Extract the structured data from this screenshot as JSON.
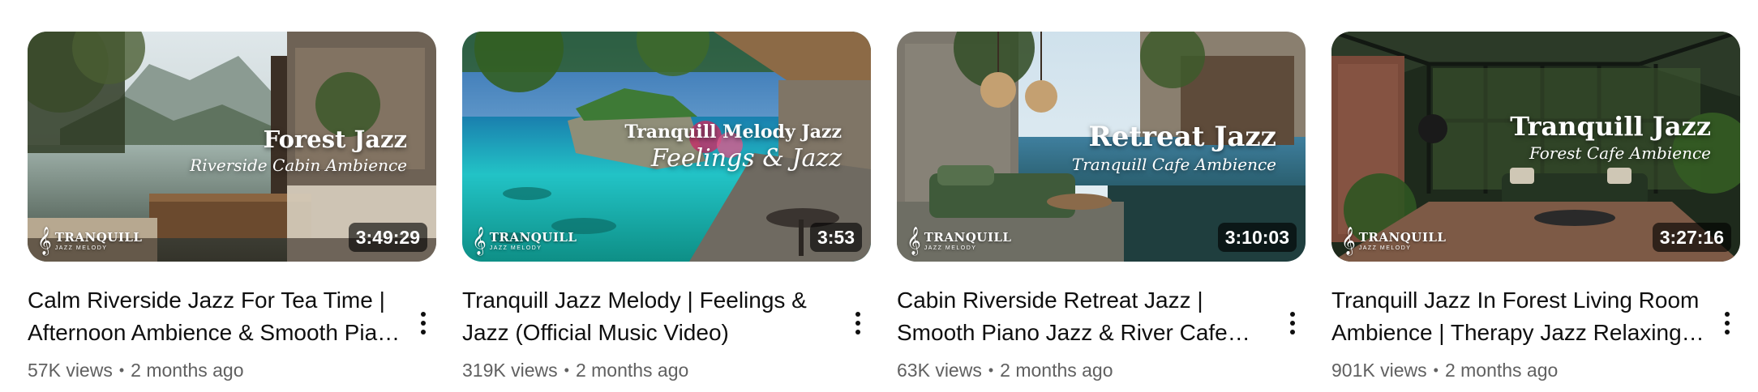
{
  "colors": {
    "title_text": "#0f0f0f",
    "secondary_text": "#606060",
    "duration_bg": "rgba(0,0,0,0.62)",
    "duration_text": "#ffffff"
  },
  "brand": {
    "name": "TRANQUILL",
    "tagline": "JAZZ MELODY"
  },
  "videos": [
    {
      "thumbnail": {
        "main": "Forest Jazz",
        "sub": "Riverside Cabin Ambience",
        "scene": "lake-cabin"
      },
      "duration": "3:49:29",
      "title": "Calm Riverside Jazz For Tea Time | Afternoon Ambience & Smooth Piano Jazz Music",
      "views": "57K views",
      "separator": "•",
      "age": "2 months ago"
    },
    {
      "thumbnail": {
        "main": "Tranquill Melody Jazz",
        "sub": "Feelings & Jazz",
        "scene": "tropical-lagoon"
      },
      "duration": "3:53",
      "title": "Tranquill Jazz Melody | Feelings & Jazz (Official Music Video)",
      "views": "319K views",
      "separator": "•",
      "age": "2 months ago"
    },
    {
      "thumbnail": {
        "main": "Retreat Jazz",
        "sub": "Tranquill Cafe Ambience",
        "scene": "seaside-retreat"
      },
      "duration": "3:10:03",
      "title": "Cabin Riverside Retreat Jazz | Smooth Piano Jazz & River Cafe Ambience",
      "views": "63K views",
      "separator": "•",
      "age": "2 months ago"
    },
    {
      "thumbnail": {
        "main": "Tranquill Jazz",
        "sub": "Forest Cafe Ambience",
        "scene": "greenhouse"
      },
      "duration": "3:27:16",
      "title": "Tranquill Jazz In Forest Living Room Ambience | Therapy Jazz Relaxing Music",
      "views": "901K views",
      "separator": "•",
      "age": "2 months ago"
    }
  ]
}
